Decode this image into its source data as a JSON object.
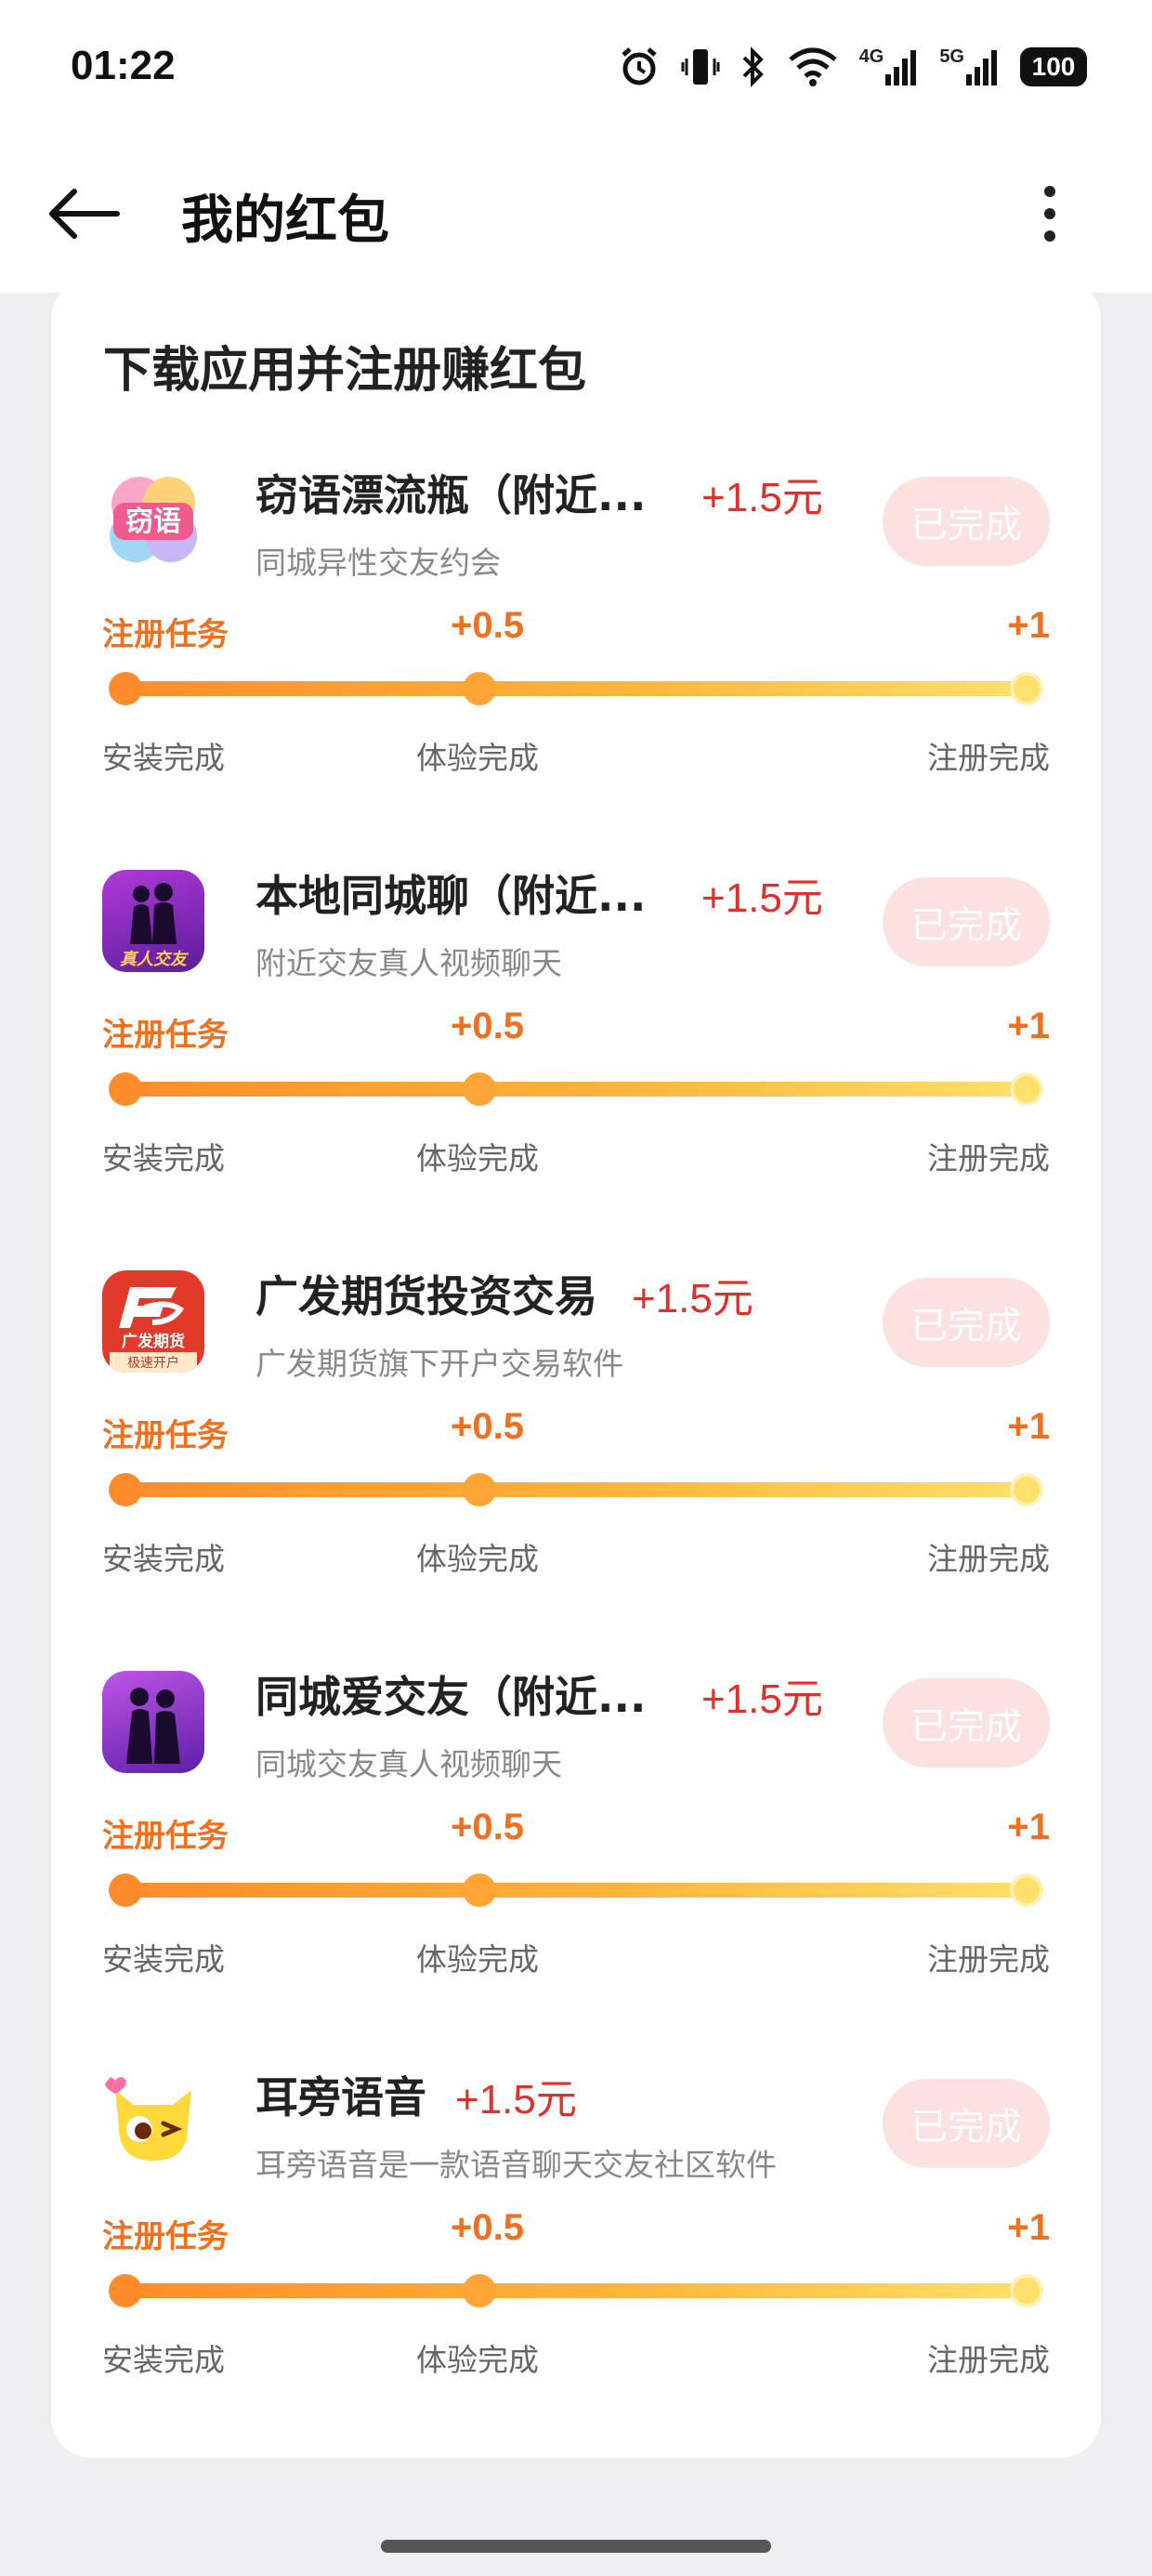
{
  "status_bar": {
    "time": "01:22",
    "battery": "100",
    "icons": [
      "alarm-icon",
      "vibrate-icon",
      "bluetooth-icon",
      "wifi-icon",
      "signal-4g-icon",
      "signal-5g-icon",
      "battery-icon"
    ],
    "network_labels": [
      "4G",
      "5G"
    ]
  },
  "nav": {
    "title": "我的红包",
    "back_icon": "back-arrow-icon",
    "more_icon": "more-vertical-icon"
  },
  "section": {
    "title": "下载应用并注册赚红包"
  },
  "tasks": [
    {
      "icon": "app-icon-qieyu",
      "icon_text": "窃语",
      "name": "窃语漂流瓶（附近...",
      "reward": "+1.5元",
      "desc": "同城异性交友约会",
      "button": "已完成",
      "task_label": "注册任务",
      "mid_reward": "+0.5",
      "end_reward": "+1",
      "steps": [
        "安装完成",
        "体验完成",
        "注册完成"
      ]
    },
    {
      "icon": "app-icon-bendi",
      "icon_text": "真人交友",
      "name": "本地同城聊（附近...",
      "reward": "+1.5元",
      "desc": "附近交友真人视频聊天",
      "button": "已完成",
      "task_label": "注册任务",
      "mid_reward": "+0.5",
      "end_reward": "+1",
      "steps": [
        "安装完成",
        "体验完成",
        "注册完成"
      ]
    },
    {
      "icon": "app-icon-guangfa",
      "icon_text": "广发期货",
      "icon_subtext": "极速开户",
      "name": "广发期货投资交易",
      "reward": "+1.5元",
      "desc": "广发期货旗下开户交易软件",
      "button": "已完成",
      "task_label": "注册任务",
      "mid_reward": "+0.5",
      "end_reward": "+1",
      "steps": [
        "安装完成",
        "体验完成",
        "注册完成"
      ]
    },
    {
      "icon": "app-icon-tongcheng",
      "name": "同城爱交友（附近...",
      "reward": "+1.5元",
      "desc": "同城交友真人视频聊天",
      "button": "已完成",
      "task_label": "注册任务",
      "mid_reward": "+0.5",
      "end_reward": "+1",
      "steps": [
        "安装完成",
        "体验完成",
        "注册完成"
      ]
    },
    {
      "icon": "app-icon-erpang",
      "name": "耳旁语音",
      "reward": "+1.5元",
      "desc": "耳旁语音是一款语音聊天交友社区软件",
      "button": "已完成",
      "task_label": "注册任务",
      "mid_reward": "+0.5",
      "end_reward": "+1",
      "steps": [
        "安装完成",
        "体验完成",
        "注册完成"
      ]
    }
  ],
  "colors": {
    "reward_red": "#e0302a",
    "task_orange": "#f07020",
    "done_button_bg": "#fde0e0",
    "progress_start": "#ff8c2a",
    "progress_end": "#ffe06a"
  }
}
